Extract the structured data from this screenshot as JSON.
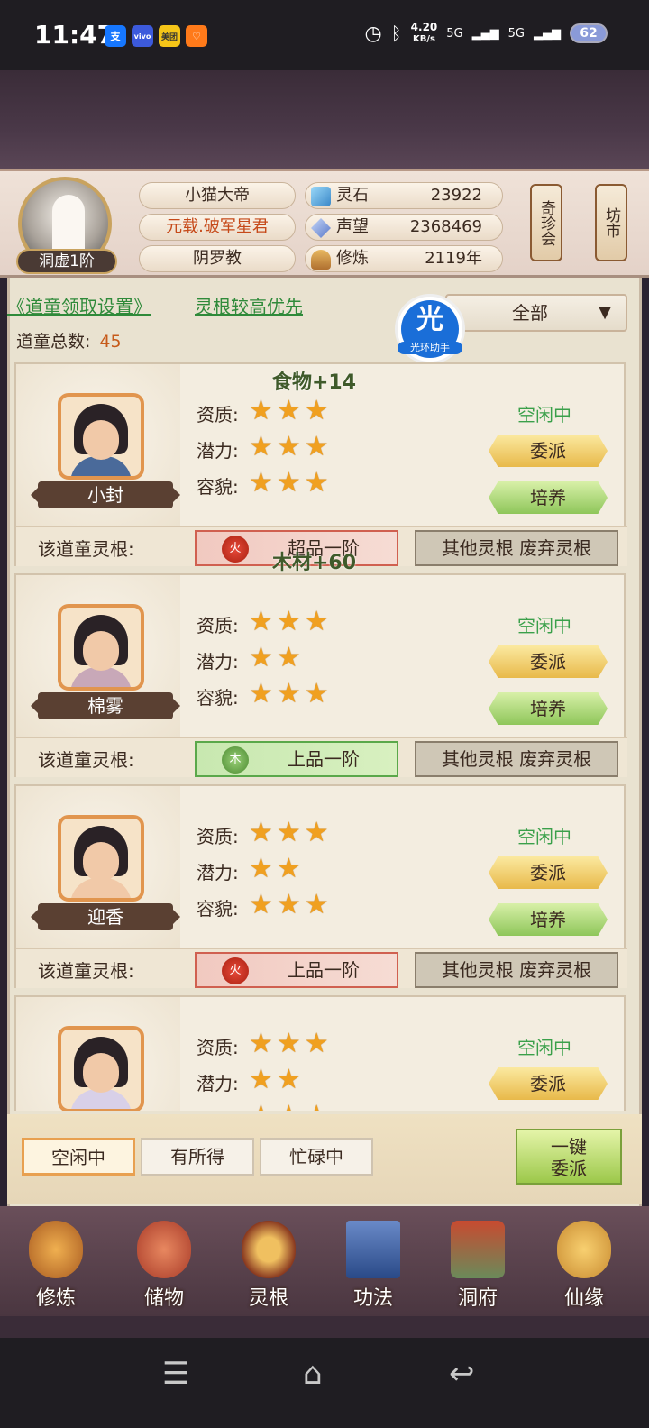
{
  "status_bar": {
    "time": "11:47",
    "apps": [
      {
        "icon": "alipay-icon",
        "text": "支",
        "color": "#1677ff"
      },
      {
        "icon": "vivo-icon",
        "text": "vivo",
        "color": "#3c5adc"
      },
      {
        "icon": "meituan-icon",
        "text": "美团",
        "color": "#f5c518"
      },
      {
        "icon": "app-icon",
        "text": "♡",
        "color": "#ff7a1a"
      }
    ],
    "net_speed": "4.20",
    "net_unit": "KB/s",
    "signal1": "5G",
    "signal2": "5G",
    "battery": "62"
  },
  "header": {
    "player_name": "小猫大帝",
    "title": "元载.破军星君",
    "sect": "阴罗教",
    "realm": "洞虚1阶",
    "resources": [
      {
        "label": "灵石",
        "value": "23922",
        "icon": "spirit-stone-icon"
      },
      {
        "label": "声望",
        "value": "2368469",
        "icon": "reputation-icon"
      },
      {
        "label": "修炼",
        "value": "2119年",
        "icon": "cultivate-icon"
      }
    ],
    "side_buttons": [
      "奇珍会",
      "坊市"
    ]
  },
  "toolbar": {
    "settings_link": "《道童领取设置》",
    "priority_link": "灵根较高优先",
    "total_label": "道童总数:",
    "total_value": "45",
    "filter_value": "全部",
    "badge_big": "光",
    "badge_small": "光环助手"
  },
  "labels": {
    "quality": "资质:",
    "potential": "潜力:",
    "looks": "容貌:",
    "root_label": "该道童灵根:",
    "other_roots": "其他灵根 废弃灵根",
    "assign": "委派",
    "train": "培养"
  },
  "children": [
    {
      "name": "小封",
      "status": "空闲中",
      "quality": "★★★",
      "potential": "★★★",
      "looks": "★★★",
      "element": "火",
      "root": "超品一阶"
    },
    {
      "name": "棉雾",
      "status": "空闲中",
      "quality": "★★★",
      "potential": "★★",
      "looks": "★★★",
      "element": "木",
      "root": "上品一阶"
    },
    {
      "name": "迎香",
      "status": "空闲中",
      "quality": "★★★",
      "potential": "★★",
      "looks": "★★★",
      "element": "火",
      "root": "上品一阶"
    },
    {
      "name": "",
      "status": "空闲中",
      "quality": "★★★",
      "potential": "★★",
      "looks": "★★★"
    }
  ],
  "floating": {
    "food": "食物+14",
    "wood": "木材+60"
  },
  "bottom_tabs": [
    "空闲中",
    "有所得",
    "忙碌中"
  ],
  "one_key": {
    "line1": "一键",
    "line2": "委派"
  },
  "nav": [
    {
      "label": "修炼",
      "icon": "cultivation-icon"
    },
    {
      "label": "储物",
      "icon": "storage-bag-icon"
    },
    {
      "label": "灵根",
      "icon": "spirit-root-icon"
    },
    {
      "label": "功法",
      "icon": "technique-book-icon"
    },
    {
      "label": "洞府",
      "icon": "cave-dwelling-icon"
    },
    {
      "label": "仙缘",
      "icon": "fortune-gourd-icon"
    }
  ],
  "system_nav": {
    "menu": "☰",
    "home": "⌂",
    "back": "↩"
  }
}
